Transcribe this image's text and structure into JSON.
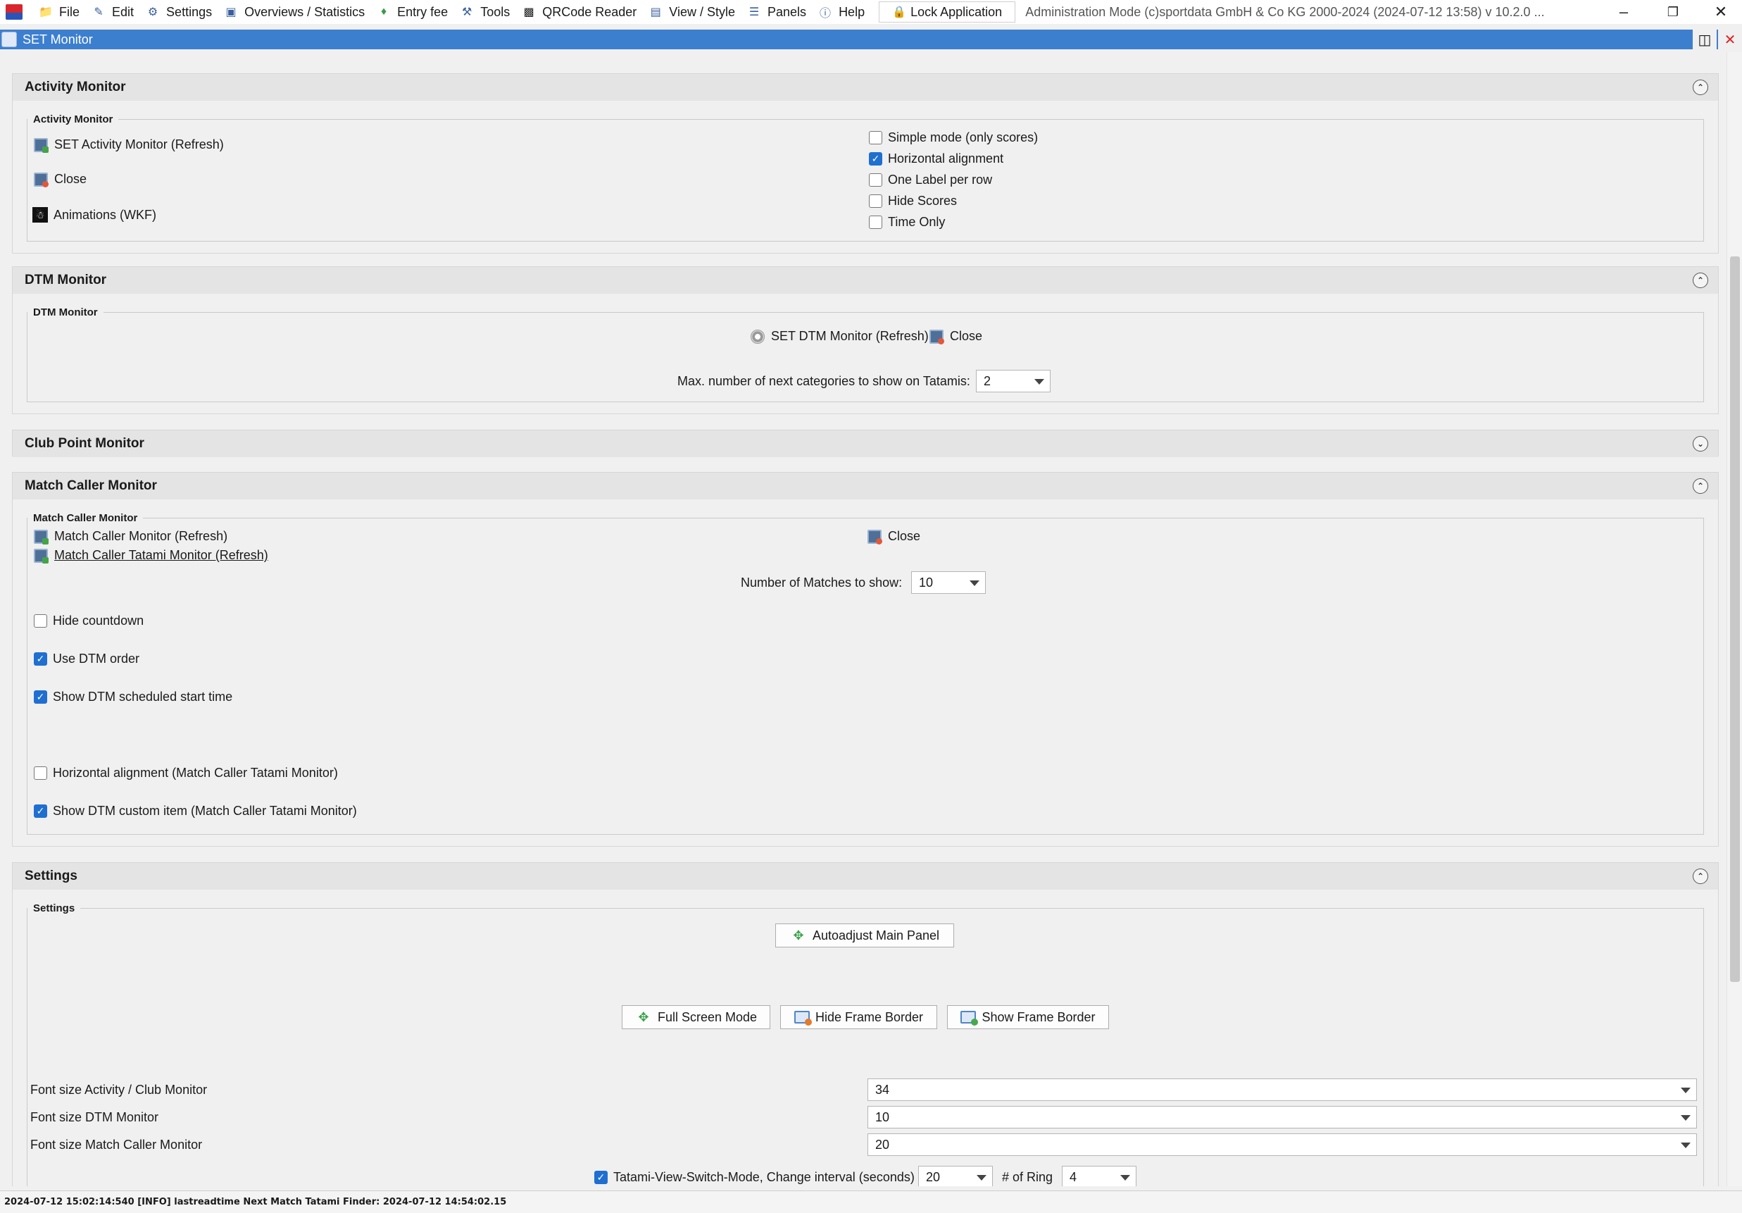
{
  "menubar": {
    "items": [
      {
        "label": "File",
        "icon": "folder-icon"
      },
      {
        "label": "Edit",
        "icon": "edit-icon"
      },
      {
        "label": "Settings",
        "icon": "gear-icon"
      },
      {
        "label": "Overviews / Statistics",
        "icon": "monitor-icon"
      },
      {
        "label": "Entry fee",
        "icon": "money-icon"
      },
      {
        "label": "Tools",
        "icon": "wrench-icon"
      },
      {
        "label": "QRCode Reader",
        "icon": "qrcode-icon"
      },
      {
        "label": "View / Style",
        "icon": "window-icon"
      },
      {
        "label": "Panels",
        "icon": "clipboard-icon"
      },
      {
        "label": "Help",
        "icon": "help-icon"
      }
    ],
    "lock_label": "Lock Application",
    "title_info": "Administration Mode (c)sportdata GmbH & Co KG 2000-2024 (2024-07-12 13:58)  v 10.2.0 ..."
  },
  "frame": {
    "title": "SET Monitor"
  },
  "activity": {
    "header": "Activity Monitor",
    "group_title": "Activity Monitor",
    "refresh_label": "SET Activity Monitor (Refresh)",
    "close_label": "Close",
    "animations_label": "Animations (WKF)",
    "options": [
      {
        "label": "Simple mode (only scores)",
        "checked": false
      },
      {
        "label": "Horizontal alignment",
        "checked": true
      },
      {
        "label": "One Label per row",
        "checked": false
      },
      {
        "label": "Hide Scores",
        "checked": false
      },
      {
        "label": "Time Only",
        "checked": false
      }
    ]
  },
  "dtm": {
    "header": "DTM Monitor",
    "group_title": "DTM Monitor",
    "refresh_label": "SET DTM Monitor (Refresh)",
    "close_label": "Close",
    "max_categories_label": "Max. number of next categories to show on Tatamis:",
    "max_categories_value": "2"
  },
  "club": {
    "header": "Club Point Monitor"
  },
  "match_caller": {
    "header": "Match Caller Monitor",
    "group_title": "Match Caller Monitor",
    "refresh_label": "Match Caller Monitor (Refresh)",
    "tatami_refresh_label": "Match Caller Tatami Monitor (Refresh)",
    "close_label": "Close",
    "matches_label": "Number of Matches to show:",
    "matches_value": "10",
    "hide_countdown": {
      "label": "Hide countdown",
      "checked": false
    },
    "use_dtm_order": {
      "label": "Use DTM order",
      "checked": true
    },
    "show_dtm_start": {
      "label": "Show DTM scheduled start time",
      "checked": true
    },
    "horizontal_alignment": {
      "label": "Horizontal alignment (Match Caller Tatami Monitor)",
      "checked": false
    },
    "show_dtm_custom": {
      "label": "Show DTM custom item (Match Caller Tatami Monitor)",
      "checked": true
    }
  },
  "settings": {
    "header": "Settings",
    "group_title": "Settings",
    "autoadjust_label": "Autoadjust Main Panel",
    "fullscreen_label": "Full Screen Mode",
    "hide_border_label": "Hide Frame Border",
    "show_border_label": "Show Frame Border",
    "font_activity_label": "Font size Activity / Club Monitor",
    "font_activity_value": "34",
    "font_dtm_label": "Font size DTM Monitor",
    "font_dtm_value": "10",
    "font_match_label": "Font size Match Caller Monitor",
    "font_match_value": "20",
    "tatami_switch_label": "Tatami-View-Switch-Mode, Change interval (seconds)",
    "tatami_switch_checked": true,
    "interval_value": "20",
    "ring_label": "# of Ring",
    "ring_value": "4"
  },
  "statusbar": {
    "text": "2024-07-12 15:02:14:540 [INFO] lastreadtime Next Match Tatami Finder: 2024-07-12 14:54:02.15"
  },
  "colors": {
    "frame_title_bg": "#3d7fcf",
    "checkbox_checked": "#1f6fd0",
    "section_header_bg": "#e4e4e4"
  }
}
